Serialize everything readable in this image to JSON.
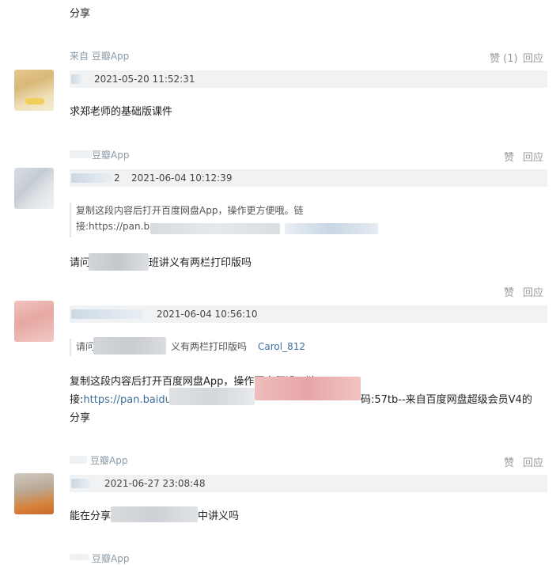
{
  "top": {
    "text": "分享"
  },
  "comments": [
    {
      "source": "来自 豆瓣App",
      "like": "赞 (1)",
      "reply": "回应",
      "date": "2021-05-20 11:52:31",
      "body": "求郑老师的基础版课件"
    },
    {
      "source": "豆瓣App",
      "like": "赞",
      "reply": "回应",
      "name_suffix": "2",
      "date": "2021-06-04 10:12:39",
      "quote_line1": "复制这段内容后打开百度网盘App，操作更方便哦。链",
      "quote_line2": "接:https://pan.ba",
      "body_prefix": "请问",
      "body_suffix": "班讲义有两栏打印版吗"
    },
    {
      "like": "赞",
      "reply": "回应",
      "date": "2021-06-04 10:56:10",
      "quote_prefix": "请问",
      "quote_suffix": "义有两栏打印版吗",
      "quote_author": "Carol_812",
      "body_line1": "复制这段内容后打开百度网盘App，操作更方便哦。链",
      "body_line2_prefix": "接:",
      "body_line2_link": "https://pan.baidu",
      "body_line2_suffix": "码:57tb--来自百度网盘超级会员V4的",
      "body_line3": "分享"
    },
    {
      "source": "豆瓣App",
      "like": "赞",
      "reply": "回应",
      "date": "2021-06-27 23:08:48",
      "body_prefix": "能在分享",
      "body_suffix": "中讲义吗"
    },
    {
      "source": "豆瓣App"
    }
  ]
}
